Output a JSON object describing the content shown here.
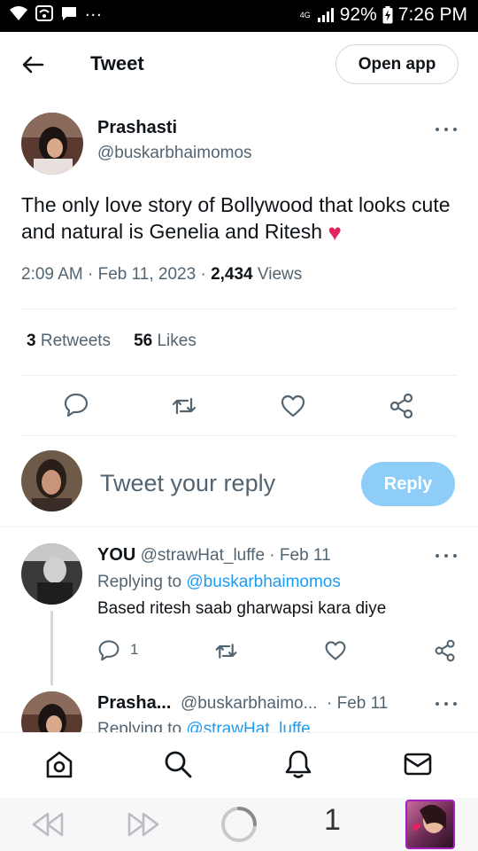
{
  "status_bar": {
    "network": "4G",
    "battery": "92%",
    "time": "7:26 PM",
    "icons": [
      "wifi-icon",
      "hotspot-icon",
      "message-icon",
      "signal-icon",
      "battery-charging-icon"
    ]
  },
  "header": {
    "back_icon": "back-arrow-icon",
    "title": "Tweet",
    "open_app_label": "Open app"
  },
  "tweet": {
    "author_name": "Prashasti",
    "author_handle": "@buskarbhaimomos",
    "text": "The only love story of Bollywood that looks cute and natural is Genelia and Ritesh",
    "emoji": "♥",
    "time": "2:09 AM",
    "date": "Feb 11, 2023",
    "views_count": "2,434",
    "views_label": "Views",
    "retweets_count": "3",
    "retweets_label": "Retweets",
    "likes_count": "56",
    "likes_label": "Likes",
    "actions": [
      "reply-icon",
      "retweet-icon",
      "like-icon",
      "share-icon"
    ]
  },
  "composer": {
    "placeholder": "Tweet your reply",
    "reply_label": "Reply"
  },
  "replies": [
    {
      "name": "YOU",
      "handle": "@strawHat_luffe",
      "date": "· Feb 11",
      "replying_prefix": "Replying to",
      "replying_to": "@buskarbhaimomos",
      "text": "Based ritesh saab gharwapsi kara diye",
      "reply_count": "1"
    },
    {
      "name": "Prasha...",
      "handle": "@buskarbhaimo...",
      "date": "· Feb 11",
      "replying_prefix": "Replying to",
      "replying_to": "@strawHat_luffe"
    }
  ],
  "bottom_nav": [
    "home-icon",
    "search-icon",
    "notifications-icon",
    "messages-icon"
  ],
  "system_bar": {
    "tab_count": "1"
  },
  "colors": {
    "accent": "#1d9bf0",
    "reply_button": "#8ecdf8",
    "secondary_text": "#536471",
    "heart": "#e0245e"
  }
}
